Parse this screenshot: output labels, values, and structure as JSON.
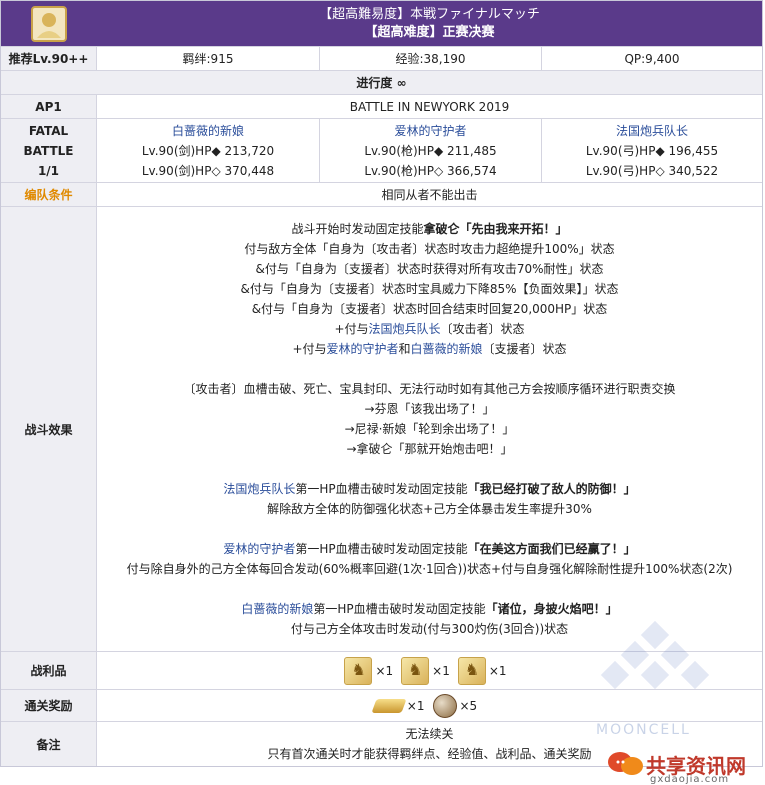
{
  "header": {
    "title_jp": "【超高難易度】本戦ファイナルマッチ",
    "title_cn": "【超高难度】正赛决赛"
  },
  "stats": {
    "level": "推荐Lv.90++",
    "bond": "羁绊:915",
    "exp": "经验:38,190",
    "qp": "QP:9,400"
  },
  "progress": "进行度 ∞",
  "ap": {
    "label": "AP1",
    "value": "BATTLE IN NEWYORK 2019"
  },
  "battle": {
    "label_line1": "FATAL",
    "label_line2": "BATTLE",
    "label_line3": "1/1",
    "enemies": [
      {
        "name": "白蔷薇的新娘",
        "hp1": "Lv.90(剑)HP◆ 213,720",
        "hp2": "Lv.90(剑)HP◇ 370,448"
      },
      {
        "name": "爱林的守护者",
        "hp1": "Lv.90(枪)HP◆ 211,485",
        "hp2": "Lv.90(枪)HP◇ 366,574"
      },
      {
        "name": "法国炮兵队长",
        "hp1": "Lv.90(弓)HP◆ 196,455",
        "hp2": "Lv.90(弓)HP◇ 340,522"
      }
    ]
  },
  "formation": {
    "label": "编队条件",
    "value": "相同从者不能出击"
  },
  "effects": {
    "label": "战斗效果",
    "l1a": "战斗开始时发动固定技能",
    "l1b": "拿破仑「先由我来开拓！」",
    "l2": "付与敌方全体「自身为〔攻击者〕状态时攻击力超绝提升100%」状态",
    "l3": "&付与「自身为〔支援者〕状态时获得对所有攻击70%耐性」状态",
    "l4": "&付与「自身为〔支援者〕状态时宝具威力下降85%【负面效果】」状态",
    "l5": "&付与「自身为〔支援者〕状态时回合结束时回复20,000HP」状态",
    "l6a": "+付与",
    "l6b": "法国炮兵队长",
    "l6c": "〔攻击者〕状态",
    "l7a": "+付与",
    "l7b": "爱林的守护者",
    "l7c": "和",
    "l7d": "白蔷薇的新娘",
    "l7e": "〔支援者〕状态",
    "l8": "〔攻击者〕血槽击破、死亡、宝具封印、无法行动时如有其他己方会按顺序循环进行职责交换",
    "l9": "→芬恩「该我出场了！」",
    "l10": "→尼禄·新娘「轮到余出场了！」",
    "l11": "→拿破仑「那就开始炮击吧！」",
    "l12a": "法国炮兵队长",
    "l12b": "第一HP血槽击破时发动固定技能",
    "l12c": "「我已经打破了敌人的防御！」",
    "l13": "解除敌方全体的防御强化状态+己方全体暴击发生率提升30%",
    "l14a": "爱林的守护者",
    "l14b": "第一HP血槽击破时发动固定技能",
    "l14c": "「在美这方面我们已经赢了！」",
    "l15": "付与除自身外的己方全体每回合发动(60%概率回避(1次·1回合))状态+付与自身强化解除耐性提升100%状态(2次)",
    "l16a": "白蔷薇的新娘",
    "l16b": "第一HP血槽击破时发动固定技能",
    "l16c": "「诸位，身披火焰吧！」",
    "l17": "付与己方全体攻击时发动(付与300灼伤(3回合))状态"
  },
  "loot": {
    "label": "战利品",
    "items": [
      {
        "icon": "golden-statue-icon",
        "qty": "×1"
      },
      {
        "icon": "golden-statue-icon",
        "qty": "×1"
      },
      {
        "icon": "golden-statue-icon",
        "qty": "×1"
      }
    ]
  },
  "rewards": {
    "label": "通关奖励",
    "items": [
      {
        "icon": "gold-ingot-icon",
        "qty": "×1"
      },
      {
        "icon": "ball-icon",
        "qty": "×5"
      }
    ]
  },
  "notes": {
    "label": "备注",
    "line1": "无法续关",
    "line2": "只有首次通关时才能获得羁绊点、经验值、战利品、通关奖励"
  },
  "watermark": "MOONCELL",
  "site_logo": {
    "name": "共享资讯网",
    "sub": "gxdaojia.com"
  }
}
